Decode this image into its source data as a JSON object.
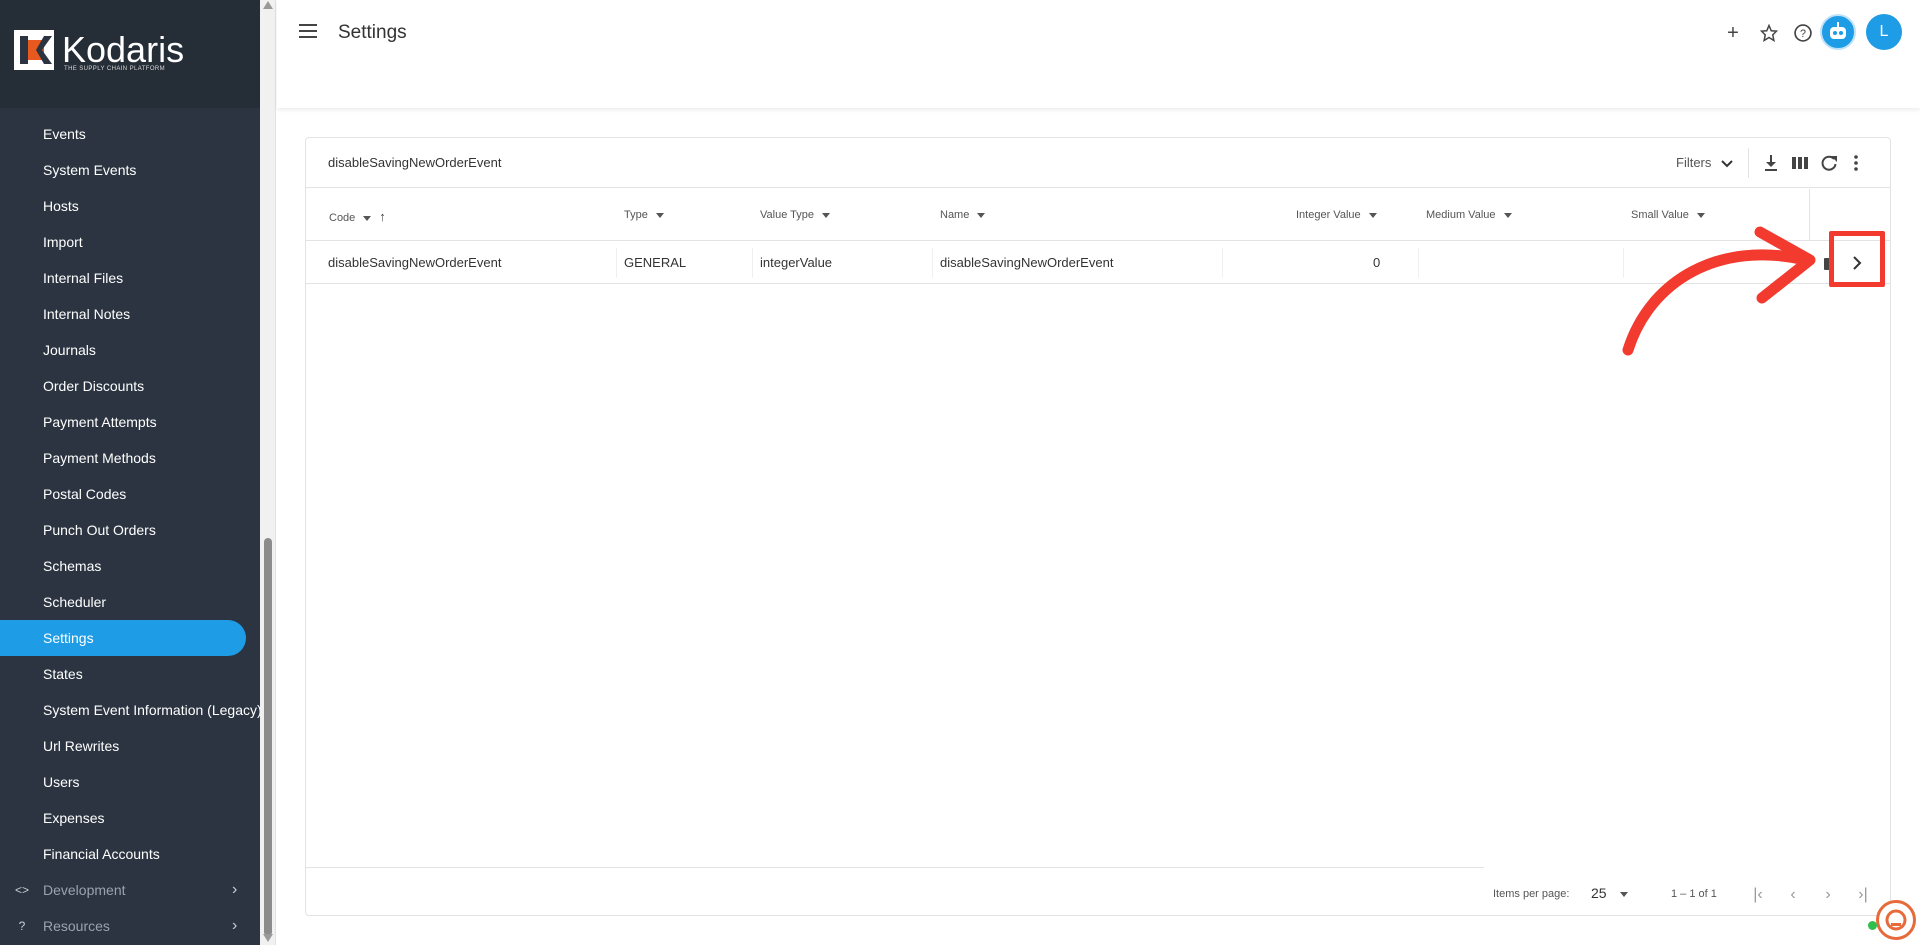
{
  "brand": {
    "name": "Kodaris",
    "tagline": "THE SUPPLY CHAIN PLATFORM"
  },
  "sidebar": {
    "items": [
      {
        "label": "Events"
      },
      {
        "label": "System Events"
      },
      {
        "label": "Hosts"
      },
      {
        "label": "Import"
      },
      {
        "label": "Internal Files"
      },
      {
        "label": "Internal Notes"
      },
      {
        "label": "Journals"
      },
      {
        "label": "Order Discounts"
      },
      {
        "label": "Payment Attempts"
      },
      {
        "label": "Payment Methods"
      },
      {
        "label": "Postal Codes"
      },
      {
        "label": "Punch Out Orders"
      },
      {
        "label": "Schemas"
      },
      {
        "label": "Scheduler"
      },
      {
        "label": "Settings",
        "active": true
      },
      {
        "label": "States"
      },
      {
        "label": "System Event Information (Legacy)"
      },
      {
        "label": "Url Rewrites"
      },
      {
        "label": "Users"
      },
      {
        "label": "Expenses"
      },
      {
        "label": "Financial Accounts"
      }
    ],
    "sections": [
      {
        "label": "Development",
        "icon": "code-icon"
      },
      {
        "label": "Resources",
        "icon": "help-circle-icon"
      }
    ]
  },
  "header": {
    "title": "Settings",
    "avatar_initial": "L",
    "accent": "#1e9ce6"
  },
  "table": {
    "search_value": "disableSavingNewOrderEvent",
    "filters_label": "Filters",
    "columns": [
      "Code",
      "Type",
      "Value Type",
      "Name",
      "Integer Value",
      "Medium Value",
      "Small Value"
    ],
    "rows": [
      {
        "code": "disableSavingNewOrderEvent",
        "type": "GENERAL",
        "value_type": "integerValue",
        "name": "disableSavingNewOrderEvent",
        "integer_value": "0",
        "medium_value": "",
        "small_value": ""
      }
    ]
  },
  "pager": {
    "items_per_page_label": "Items per page:",
    "items_per_page": "25",
    "range": "1 – 1 of 1"
  },
  "annotation": {
    "color": "#f23a2f"
  }
}
